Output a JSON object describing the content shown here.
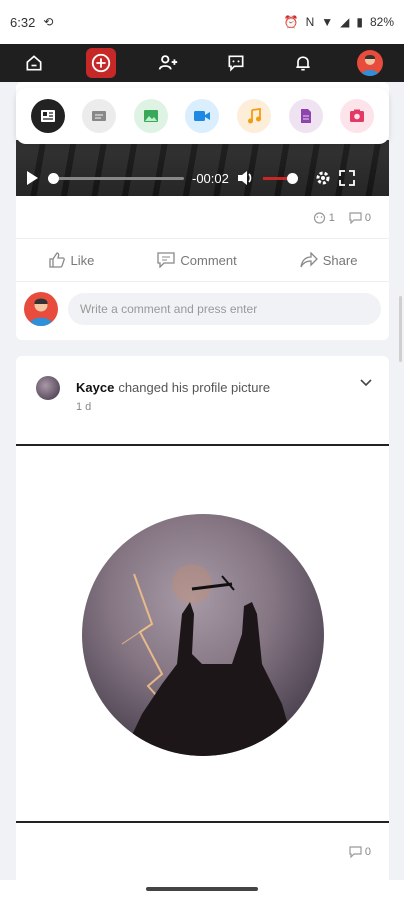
{
  "status": {
    "time": "6:32",
    "battery": "82%"
  },
  "nav": {
    "items": [
      {
        "name": "home-nav",
        "icon": "home-icon"
      },
      {
        "name": "create-post-nav",
        "icon": "plus-icon",
        "active": true
      },
      {
        "name": "add-friend-nav",
        "icon": "add-user-icon"
      },
      {
        "name": "messages-nav",
        "icon": "chat-icon"
      },
      {
        "name": "notifications-nav",
        "icon": "bell-icon"
      },
      {
        "name": "profile-nav",
        "icon": "avatar"
      }
    ],
    "active_color": "#c62828"
  },
  "composer": {
    "tools": [
      "article-icon",
      "text-icon",
      "image-icon",
      "video-icon",
      "music-icon",
      "file-icon",
      "photo-album-icon"
    ]
  },
  "video": {
    "time_remaining": "-00:02"
  },
  "post1": {
    "reaction_count": "1",
    "comment_count": "0",
    "actions": {
      "like": "Like",
      "comment": "Comment",
      "share": "Share"
    },
    "comment_placeholder": "Write a comment and press enter"
  },
  "post2": {
    "author": "Kayce",
    "activity": "changed his profile picture",
    "time": "1 d",
    "comment_count": "0"
  }
}
